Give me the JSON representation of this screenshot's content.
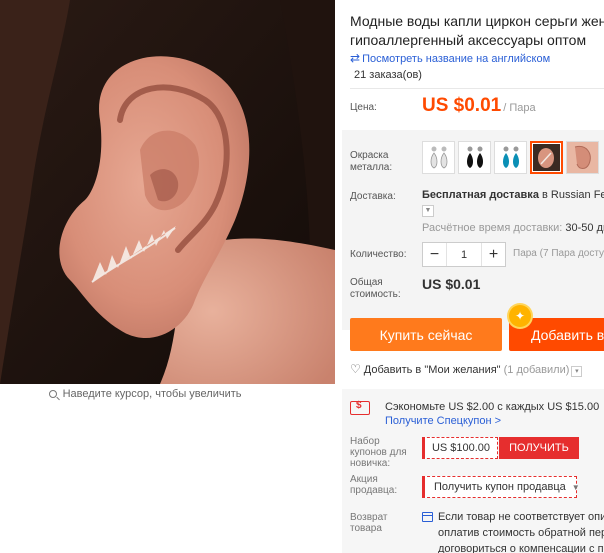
{
  "product": {
    "title_line1": "Модные воды капли циркон серьги женские",
    "title_line2": "гипоаллергенный аксессуары оптом",
    "translate_link": "Посмотреть название на английском",
    "orders": "21 заказа(ов)"
  },
  "image": {
    "zoom_hint": "Наведите курсор, чтобы увеличить"
  },
  "price": {
    "label": "Цена:",
    "value": "US $0.01",
    "unit": "/ Пара",
    "color": "#ff4a00"
  },
  "color_option": {
    "label_line1": "Окраска",
    "label_line2": "металла:",
    "swatches": [
      {
        "name": "clear-crystal-drop",
        "selected": false
      },
      {
        "name": "black-crystal-drop",
        "selected": false
      },
      {
        "name": "blue-crystal-drop",
        "selected": false
      },
      {
        "name": "leaf-ear-climber",
        "selected": true
      },
      {
        "name": "ear-photo",
        "selected": false
      }
    ]
  },
  "shipping": {
    "label": "Доставка:",
    "bold": "Бесплатная доставка",
    "to": "в Russian Fede",
    "time_label": "Расчётное время доставки:",
    "time_value": "30-50 дн"
  },
  "quantity": {
    "label": "Количество:",
    "minus": "−",
    "value": "1",
    "plus": "+",
    "note": "Пара (7 Пара досту"
  },
  "total": {
    "label_line1": "Общая",
    "label_line2": "стоимость:",
    "value": "US $0.01"
  },
  "actions": {
    "buy_now": "Купить сейчас",
    "add_to_cart": "Добавить в",
    "cart_badge": "✦",
    "buy_color": "#ff7a1c",
    "cart_color": "#ff4a00"
  },
  "wishlist": {
    "icon": "♡",
    "text": "Добавить в \"Мои желания\"",
    "count": "(1 добавили)",
    "dropdown": "▾"
  },
  "coupons": {
    "save_text": "Сэкономьте US $2.00 с каждых US $15.00",
    "save_link": "Получите Спецкупон >",
    "newbie_line1": "Набор",
    "newbie_line2": "купонов для",
    "newbie_line3": "новичка:",
    "newbie_value": "US $100.00",
    "newbie_button": "ПОЛУЧИТЬ",
    "seller_line1": "Акция",
    "seller_line2": "продавца:",
    "seller_button": "Получить купон продавца",
    "seller_arrow": "▼"
  },
  "returns": {
    "label_line1": "Возврат",
    "label_line2": "товара",
    "line1": "Если товар не соответствует описа",
    "line2": "оплатив стоимость обратной перес",
    "line3": "договориться о компенсации с пр"
  }
}
